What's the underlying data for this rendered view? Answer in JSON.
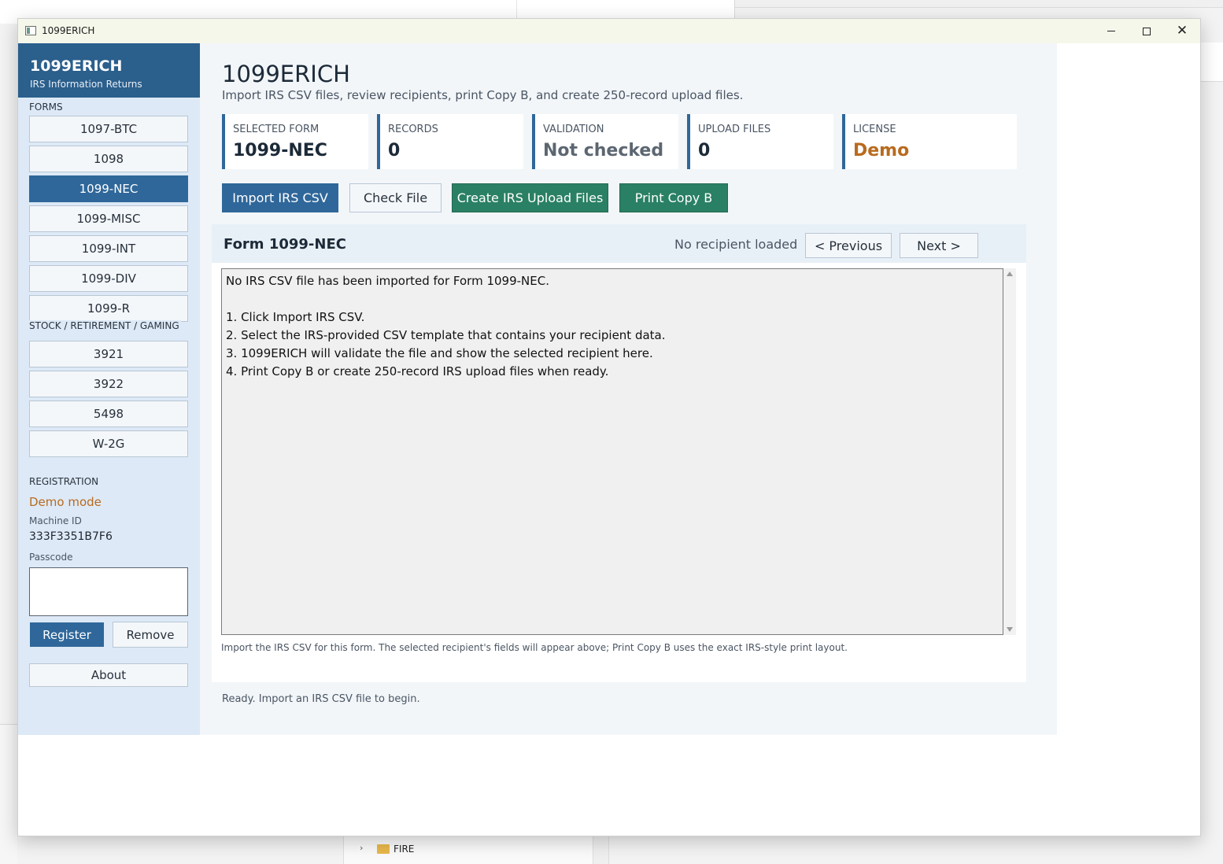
{
  "window": {
    "title": "1099ERICH"
  },
  "sidebar": {
    "brand_name": "1099ERICH",
    "brand_sub": "IRS Information Returns",
    "forms_label": "FORMS",
    "forms": [
      "1097-BTC",
      "1098",
      "1099-NEC",
      "1099-MISC",
      "1099-INT",
      "1099-DIV",
      "1099-R"
    ],
    "stock_label": "STOCK / RETIREMENT / GAMING",
    "stock_forms": [
      "3921",
      "3922",
      "5498",
      "W-2G"
    ],
    "registration_label": "REGISTRATION",
    "demo_mode": "Demo mode",
    "machine_id_label": "Machine ID",
    "machine_id": "333F3351B7F6",
    "passcode_label": "Passcode",
    "passcode_value": "",
    "register_label": "Register",
    "remove_label": "Remove",
    "about_label": "About"
  },
  "main": {
    "title": "1099ERICH",
    "subtitle": "Import IRS CSV files, review recipients, print Copy B, and create 250-record upload files.",
    "cards": [
      {
        "label": "SELECTED FORM",
        "value": "1099-NEC"
      },
      {
        "label": "RECORDS",
        "value": "0"
      },
      {
        "label": "VALIDATION",
        "value": "Not checked"
      },
      {
        "label": "UPLOAD FILES",
        "value": "0"
      },
      {
        "label": "LICENSE",
        "value": "Demo"
      }
    ],
    "actions": {
      "import": "Import IRS CSV",
      "check": "Check File",
      "create": "Create IRS Upload Files",
      "print": "Print Copy B"
    },
    "form_panel": {
      "title": "Form 1099-NEC",
      "status": "No recipient loaded",
      "previous": "< Previous",
      "next": "Next >",
      "text_lines": [
        "No IRS CSV file has been imported for Form 1099-NEC.",
        "",
        "1. Click Import IRS CSV.",
        "2. Select the IRS-provided CSV template that contains your recipient data.",
        "3. 1099ERICH will validate the file and show the selected recipient here.",
        "4. Print Copy B or create 250-record IRS upload files when ready."
      ],
      "hint": "Import the IRS CSV for this form. The selected recipient's fields will appear above; Print Copy B uses the exact IRS-style print layout."
    },
    "status_bar": "Ready. Import an IRS CSV file to begin."
  },
  "background": {
    "explorer_folder": "FIRE"
  },
  "colors": {
    "brand": "#2b5f8c",
    "accent_blue": "#2f679a",
    "accent_green": "#2a8064",
    "demo_orange": "#b86b1f",
    "sidebar_bg": "#dde9f6"
  }
}
